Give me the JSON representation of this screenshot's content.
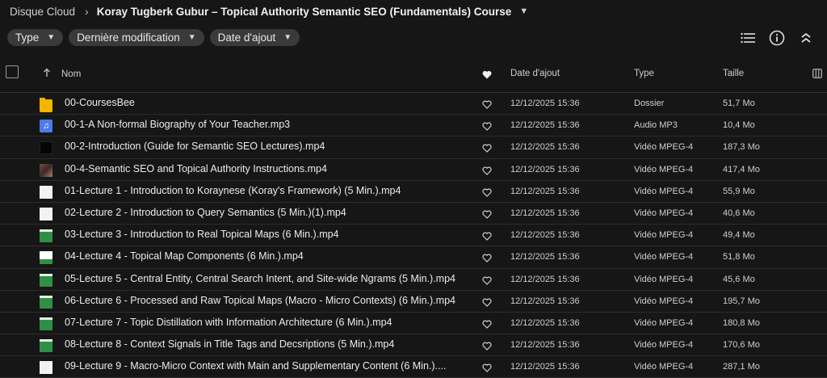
{
  "breadcrumb": {
    "root": "Disque Cloud",
    "current": "Koray Tugberk Gubur – Topical Authority Semantic SEO (Fundamentals) Course"
  },
  "filters": [
    {
      "label": "Type"
    },
    {
      "label": "Dernière modification"
    },
    {
      "label": "Date d'ajout"
    }
  ],
  "toolbar_icons": [
    "list-view-icon",
    "info-icon",
    "collapse-icon"
  ],
  "columns": {
    "name": "Nom",
    "date": "Date d'ajout",
    "type": "Type",
    "size": "Taille"
  },
  "files": [
    {
      "icon": "folder",
      "name": "00-CoursesBee",
      "date": "12/12/2025 15:36",
      "type": "Dossier",
      "size": "51,7 Mo"
    },
    {
      "icon": "audio",
      "name": "00-1-A Non-formal Biography of Your Teacher.mp3",
      "date": "12/12/2025 15:36",
      "type": "Audio MP3",
      "size": "10,4 Mo"
    },
    {
      "icon": "black",
      "name": "00-2-Introduction (Guide for Semantic SEO Lectures).mp4",
      "date": "12/12/2025 15:36",
      "type": "Vidéo MPEG-4",
      "size": "187,3 Mo"
    },
    {
      "icon": "photo",
      "name": "00-4-Semantic SEO and Topical Authority Instructions.mp4",
      "date": "12/12/2025 15:36",
      "type": "Vidéo MPEG-4",
      "size": "417,4 Mo"
    },
    {
      "icon": "white",
      "name": "01-Lecture 1 - Introduction to Koraynese (Koray's Framework) (5 Min.).mp4",
      "date": "12/12/2025 15:36",
      "type": "Vidéo MPEG-4",
      "size": "55,9 Mo"
    },
    {
      "icon": "white",
      "name": "02-Lecture 2 - Introduction to Query Semantics (5 Min.)(1).mp4",
      "date": "12/12/2025 15:36",
      "type": "Vidéo MPEG-4",
      "size": "40,6 Mo"
    },
    {
      "icon": "green",
      "name": "03-Lecture 3 - Introduction to Real Topical Maps (6 Min.).mp4",
      "date": "12/12/2025 15:36",
      "type": "Vidéo MPEG-4",
      "size": "49,4 Mo"
    },
    {
      "icon": "greenw",
      "name": "04-Lecture 4 - Topical Map Components (6 Min.).mp4",
      "date": "12/12/2025 15:36",
      "type": "Vidéo MPEG-4",
      "size": "51,8 Mo"
    },
    {
      "icon": "green",
      "name": "05-Lecture 5 - Central Entity, Central Search Intent, and Site-wide Ngrams (5 Min.).mp4",
      "date": "12/12/2025 15:36",
      "type": "Vidéo MPEG-4",
      "size": "45,6 Mo"
    },
    {
      "icon": "green",
      "name": "06-Lecture 6 - Processed and Raw Topical Maps (Macro - Micro Contexts) (6 Min.).mp4",
      "date": "12/12/2025 15:36",
      "type": "Vidéo MPEG-4",
      "size": "195,7 Mo"
    },
    {
      "icon": "green",
      "name": "07-Lecture 7 - Topic Distillation with Information Architecture (6 Min.).mp4",
      "date": "12/12/2025 15:36",
      "type": "Vidéo MPEG-4",
      "size": "180,8 Mo"
    },
    {
      "icon": "green",
      "name": "08-Lecture 8 - Context Signals in Title Tags and Decsriptions (5 Min.).mp4",
      "date": "12/12/2025 15:36",
      "type": "Vidéo MPEG-4",
      "size": "170,6 Mo"
    },
    {
      "icon": "white",
      "name": "09-Lecture 9 - Macro-Micro Context with Main and Supplementary Content (6 Min.)....",
      "date": "12/12/2025 15:36",
      "type": "Vidéo MPEG-4",
      "size": "287,1 Mo"
    }
  ]
}
